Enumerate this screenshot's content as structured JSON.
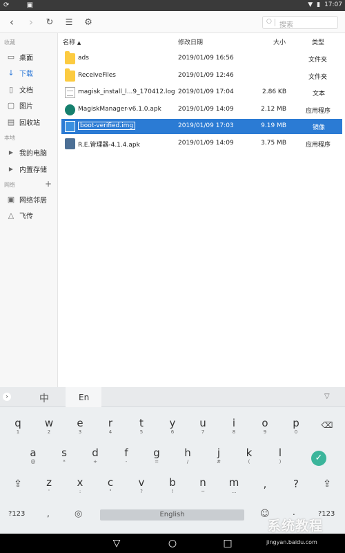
{
  "status_bar": {
    "time": "17:07"
  },
  "toolbar": {
    "search_placeholder": "搜索"
  },
  "sidebar": {
    "favorites_header": "收藏",
    "favorites": [
      {
        "label": "桌面",
        "icon": "desktop-icon"
      },
      {
        "label": "下载",
        "icon": "download-icon",
        "active": true
      },
      {
        "label": "文档",
        "icon": "document-icon"
      },
      {
        "label": "图片",
        "icon": "picture-icon"
      },
      {
        "label": "回收站",
        "icon": "trash-icon"
      }
    ],
    "local_header": "本地",
    "local": [
      {
        "label": "我的电脑"
      },
      {
        "label": "内置存储"
      }
    ],
    "network_header": "网络",
    "network": [
      {
        "label": "网络邻居",
        "icon": "network-icon"
      },
      {
        "label": "飞传",
        "icon": "fly-transfer-icon"
      }
    ]
  },
  "file_list": {
    "columns": {
      "name": "名称",
      "date": "修改日期",
      "size": "大小",
      "type": "类型"
    },
    "rows": [
      {
        "name": "ads",
        "date": "2019/01/09 16:56",
        "size": "",
        "type": "文件夹",
        "icon": "folder-icon"
      },
      {
        "name": "ReceiveFiles",
        "date": "2019/01/09 12:46",
        "size": "",
        "type": "文件夹",
        "icon": "folder-icon"
      },
      {
        "name": "magisk_install_l...9_170412.log",
        "date": "2019/01/09 17:04",
        "size": "2.86 KB",
        "type": "文本",
        "icon": "text-file-icon"
      },
      {
        "name": "MagiskManager-v6.1.0.apk",
        "date": "2019/01/09 14:09",
        "size": "2.12 MB",
        "type": "应用程序",
        "icon": "magisk-apk-icon"
      },
      {
        "name": "boot-verified.img",
        "date": "2019/01/09 17:03",
        "size": "9.19 MB",
        "type": "镜像",
        "icon": "image-file-icon",
        "selected": true
      },
      {
        "name": "R.E.管理器-4.1.4.apk",
        "date": "2019/01/09 14:09",
        "size": "3.75 MB",
        "type": "应用程序",
        "icon": "re-apk-icon"
      }
    ]
  },
  "keyboard": {
    "lang_zh": "中",
    "lang_en": "En",
    "row1": [
      {
        "m": "q",
        "s": "1"
      },
      {
        "m": "w",
        "s": "2"
      },
      {
        "m": "e",
        "s": "3"
      },
      {
        "m": "r",
        "s": "4"
      },
      {
        "m": "t",
        "s": "5"
      },
      {
        "m": "y",
        "s": "6"
      },
      {
        "m": "u",
        "s": "7"
      },
      {
        "m": "i",
        "s": "8"
      },
      {
        "m": "o",
        "s": "9"
      },
      {
        "m": "p",
        "s": "0"
      }
    ],
    "row2": [
      {
        "m": "a",
        "s": "@"
      },
      {
        "m": "s",
        "s": "*"
      },
      {
        "m": "d",
        "s": "+"
      },
      {
        "m": "f",
        "s": "-"
      },
      {
        "m": "g",
        "s": "="
      },
      {
        "m": "h",
        "s": "/"
      },
      {
        "m": "j",
        "s": "#"
      },
      {
        "m": "k",
        "s": "("
      },
      {
        "m": "l",
        "s": ")"
      }
    ],
    "row3": [
      {
        "m": "z",
        "s": "'"
      },
      {
        "m": "x",
        "s": ":"
      },
      {
        "m": "c",
        "s": "\""
      },
      {
        "m": "v",
        "s": "?"
      },
      {
        "m": "b",
        "s": "!"
      },
      {
        "m": "n",
        "s": "~"
      },
      {
        "m": "m",
        "s": "…"
      }
    ],
    "row3_extra": [
      ",",
      "?"
    ],
    "symbols_label": "?123",
    "comma": ",",
    "space_label": "English",
    "period": ".",
    "symbols_label_right": "?123"
  },
  "watermark": {
    "text": "系统教程",
    "sub": "jingyan.baidu.com"
  },
  "colors": {
    "selection": "#2b7bd4",
    "accent": "#2f7ad8",
    "folder": "#fccb41",
    "confirm": "#3bb59b"
  }
}
